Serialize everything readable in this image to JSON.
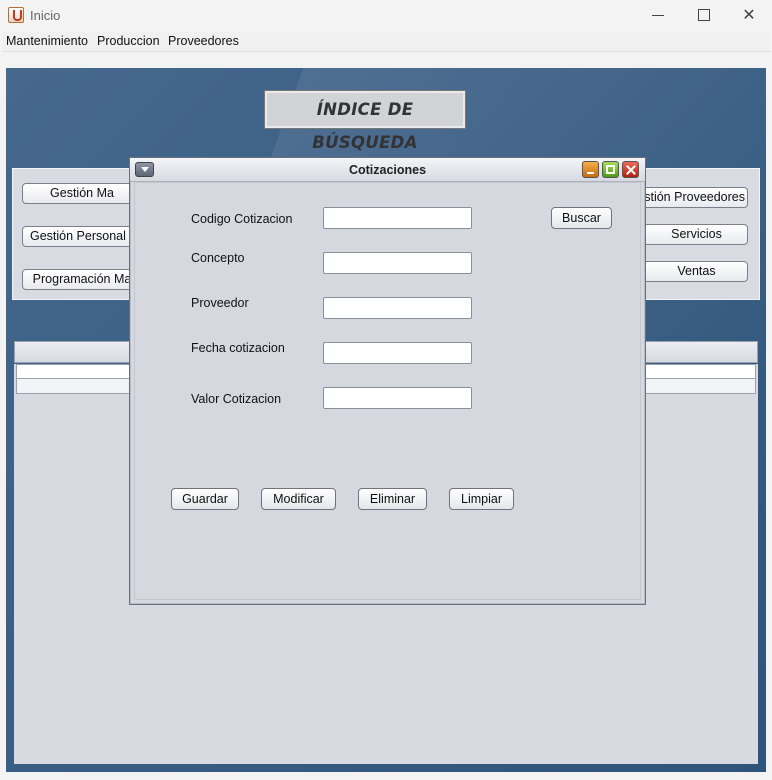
{
  "window": {
    "title": "Inicio",
    "app_icon": "java-cup-icon"
  },
  "menubar": {
    "items": [
      "Mantenimiento",
      "Produccion",
      "Proveedores"
    ]
  },
  "desktop": {
    "banner": "ÍNDICE DE BÚSQUEDA",
    "left_buttons": [
      "Gestión Ma",
      "Gestión Personal",
      "Programación Ma"
    ],
    "right_buttons": [
      "stión Proveedores",
      "Servicios",
      "Ventas"
    ]
  },
  "internal_frame": {
    "title": "Cotizaciones",
    "fields": [
      {
        "label": "Codigo Cotizacion",
        "value": ""
      },
      {
        "label": "Concepto",
        "value": ""
      },
      {
        "label": "Proveedor",
        "value": ""
      },
      {
        "label": "Fecha cotizacion",
        "value": ""
      },
      {
        "label": "Valor Cotizacion",
        "value": ""
      }
    ],
    "search_button": "Buscar",
    "actions": [
      "Guardar",
      "Modificar",
      "Eliminar",
      "Limpiar"
    ]
  },
  "colors": {
    "desktop_background": "#3b5f85",
    "panel_background": "#d9dbe2",
    "minimize_button": "#e08a2a",
    "maximize_button": "#6fb52e",
    "close_button": "#d23b28"
  }
}
